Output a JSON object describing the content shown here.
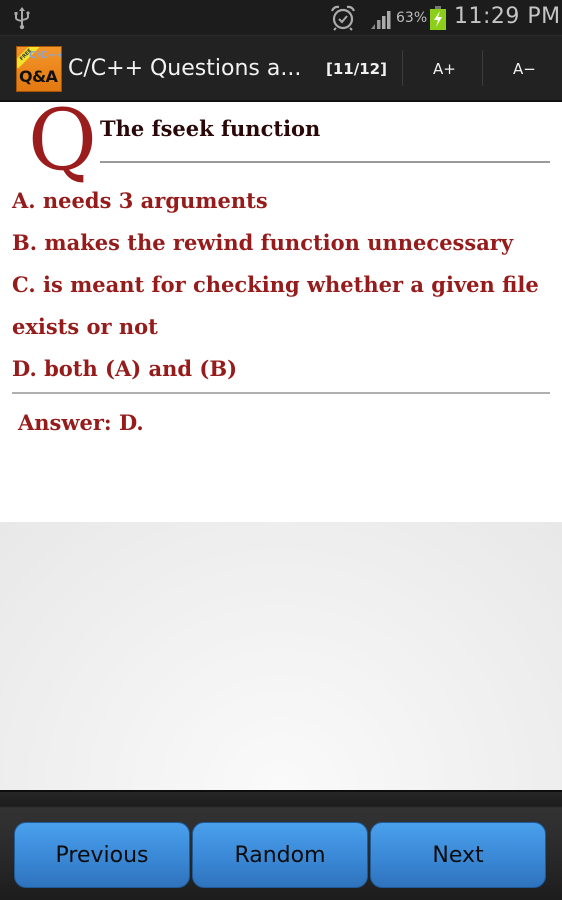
{
  "status_bar": {
    "left_icons": [
      "usb-icon"
    ],
    "right_icons": [
      "alarm-icon",
      "signal-icon",
      "battery-charging-icon"
    ],
    "battery_percent": "63%",
    "time": "11:29 PM",
    "battery_color": "#8ccf1a"
  },
  "action_bar": {
    "app_icon": {
      "badge": "FREE",
      "line1": "C/C++",
      "line2": "Q&A"
    },
    "title": "C/C++ Questions a...",
    "counter": "[11/12]",
    "increase_font_label": "A+",
    "decrease_font_label": "A−"
  },
  "question": {
    "marker": "Q",
    "text": "The fseek function",
    "options": [
      " A. needs 3 arguments",
      " B. makes the rewind function unnecessary",
      " C. is meant for checking whether a given file",
      "exists or not",
      " D. both (A) and (B)"
    ],
    "answer": "Answer: D."
  },
  "navigation": {
    "previous_label": "Previous",
    "random_label": "Random",
    "next_label": "Next"
  },
  "colors": {
    "accent_text": "#961b1b",
    "question_text": "#2a0808",
    "button_blue": "#3a88d6"
  }
}
